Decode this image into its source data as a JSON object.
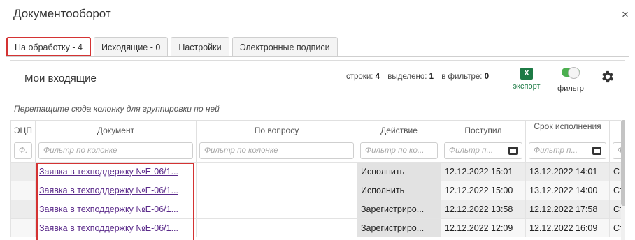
{
  "dialog": {
    "title": "Документооборот",
    "close_glyph": "×"
  },
  "tabs": [
    {
      "label": "На обработку - 4",
      "active": true
    },
    {
      "label": "Исходящие - 0",
      "active": false
    },
    {
      "label": "Настройки",
      "active": false
    },
    {
      "label": "Электронные подписи",
      "active": false
    }
  ],
  "panel": {
    "title": "Мои входящие",
    "stats": {
      "rows_label": "строки:",
      "rows": "4",
      "selected_label": "выделено:",
      "selected": "1",
      "filtered_label": "в фильтре:",
      "filtered": "0"
    },
    "export": {
      "icon_text": "X",
      "label": "экспорт",
      "color": "#1d7a45"
    },
    "filter": {
      "label": "фильтр",
      "enabled": true,
      "color": "#4caf50"
    },
    "settings_icon": "gear-icon",
    "group_hint": "Перетащите сюда колонку для группировки по ней"
  },
  "grid": {
    "columns": [
      {
        "key": "ecp",
        "label": "ЭЦП",
        "filter": "Ф."
      },
      {
        "key": "doc",
        "label": "Документ",
        "filter": "Фильтр по колонке"
      },
      {
        "key": "question",
        "label": "По вопросу",
        "filter": "Фильтр по колонке"
      },
      {
        "key": "action",
        "label": "Действие",
        "filter": "Фильтр по ко..."
      },
      {
        "key": "received",
        "label": "Поступил",
        "filter": "Фильтр п..."
      },
      {
        "key": "deadline",
        "label": "Срок исполнения",
        "filter": "Фильтр п..."
      },
      {
        "key": "extra",
        "label": "",
        "filter": "Ф"
      }
    ],
    "rows": [
      {
        "ecp": "",
        "doc": "Заявка в техподдержку №Е-06/1...",
        "question": "",
        "action": "Исполнить",
        "received": "12.12.2022 15:01",
        "deadline": "13.12.2022 14:01",
        "extra": "Ст"
      },
      {
        "ecp": "",
        "doc": "Заявка в техподдержку №Е-06/1...",
        "question": "",
        "action": "Исполнить",
        "received": "12.12.2022 15:00",
        "deadline": "13.12.2022 14:00",
        "extra": "Ст"
      },
      {
        "ecp": "",
        "doc": "Заявка в техподдержку №Е-06/1...",
        "question": "",
        "action": "Зарегистриро...",
        "received": "12.12.2022 13:58",
        "deadline": "12.12.2022 17:58",
        "extra": "Ст"
      },
      {
        "ecp": "",
        "doc": "Заявка в техподдержку №Е-06/1...",
        "question": "",
        "action": "Зарегистриро...",
        "received": "12.12.2022 12:09",
        "deadline": "12.12.2022 16:09",
        "extra": "Ст"
      }
    ]
  }
}
